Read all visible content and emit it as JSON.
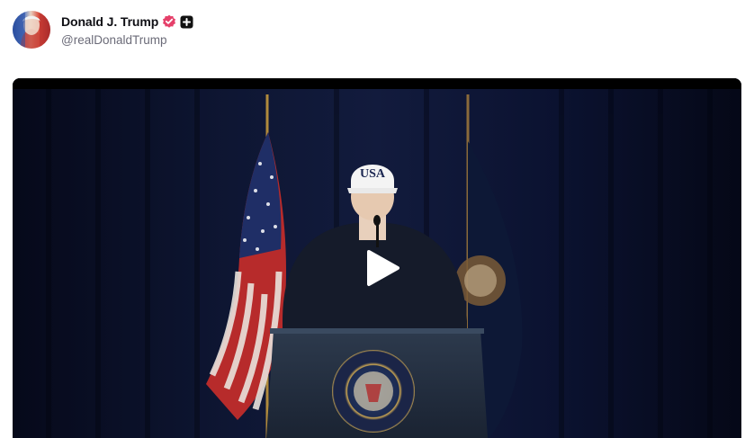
{
  "post": {
    "author": {
      "display_name": "Donald J. Trump",
      "handle": "@realDonaldTrump",
      "verified": true,
      "verified_color": "#e5406a",
      "badge_icon": "plus-square-icon"
    },
    "media": {
      "type": "video",
      "cap_text": "USA",
      "play_icon": "play-icon"
    }
  }
}
